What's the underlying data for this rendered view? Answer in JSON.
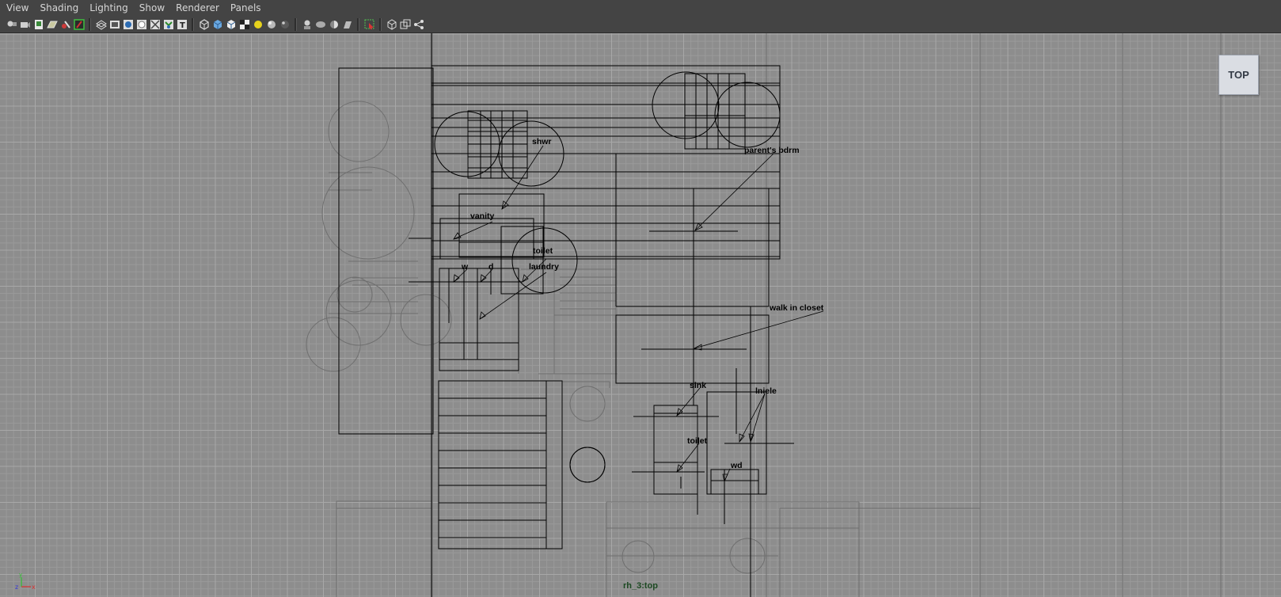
{
  "menubar": {
    "items": [
      "View",
      "Shading",
      "Lighting",
      "Show",
      "Renderer",
      "Panels"
    ]
  },
  "toolbar": {
    "icons": [
      "select-camera-icon",
      "camera-attributes-icon",
      "bookmarks-icon",
      "image-plane-icon",
      "grid-icon",
      "film-gate-icon",
      "resolution-gate-icon",
      "safe-action-icon",
      "xray-icon",
      "wireframe-icon",
      "smooth-shade-icon",
      "default-material-icon",
      "textured-icon",
      "use-all-lights-icon",
      "shadows-icon",
      "isolate-select-icon",
      "high-quality-icon",
      "xray-joints-icon",
      "backface-icon",
      "select-mode-icon",
      "frame-all-icon",
      "frame-selection-icon",
      "graph-icon"
    ]
  },
  "viewport": {
    "view_cube_label": "TOP",
    "camera_name": "rh_3:top",
    "axis": {
      "y": "y",
      "z": "z",
      "x": "x"
    },
    "labels": {
      "shwr": "shwr",
      "parents_bdrm": "parent's bdrm",
      "vanity": "vanity",
      "toilet_top": "toilet",
      "laundry": "laundry",
      "w": "w",
      "d": "d",
      "walk_in_closet": "walk in closet",
      "sink": "sink",
      "toilet_bottom": "toilet",
      "lniele": "lniele",
      "wd": "wd"
    }
  },
  "colors": {
    "background": "#8d8d8d",
    "grid_minor": "#9a9a9a",
    "grid_major": "#a8a8a8",
    "menubar": "#444444",
    "curve_active": "#000000",
    "curve_template": "#6f6f6f",
    "camera_label": "#1d4a23"
  }
}
